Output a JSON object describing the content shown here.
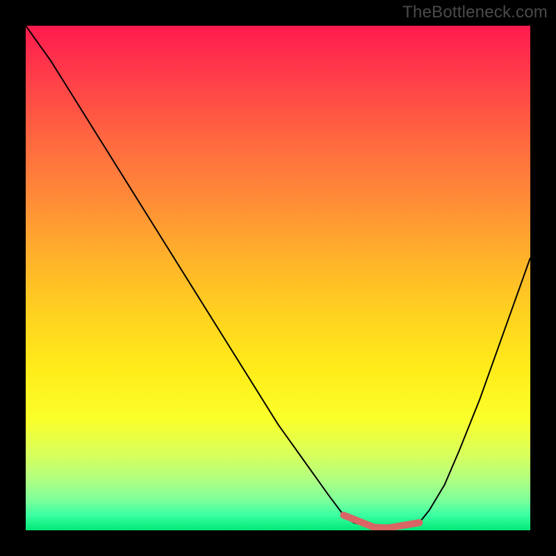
{
  "attribution": "TheBottleneck.com",
  "chart_data": {
    "type": "line",
    "title": "",
    "xlabel": "",
    "ylabel": "",
    "xlim": [
      0,
      100
    ],
    "ylim": [
      0,
      100
    ],
    "x": [
      0,
      5,
      10,
      15,
      20,
      25,
      30,
      35,
      40,
      45,
      50,
      55,
      60,
      63,
      65,
      68,
      70,
      72,
      75,
      78,
      80,
      83,
      86,
      90,
      95,
      100
    ],
    "values": [
      100,
      93,
      85,
      77,
      69,
      61,
      53,
      45,
      37,
      29,
      21,
      14,
      7,
      3,
      1.5,
      0.7,
      0.5,
      0.5,
      0.7,
      1.5,
      4,
      9,
      16,
      26,
      40,
      54
    ],
    "flat_region_x": [
      63,
      78
    ],
    "annotations": "A V-shaped curve descending linearly from upper-left, flattening near the bottom between ~63% and ~78% x (highlighted in red), then rising toward the right edge with increasing slope."
  },
  "colors": {
    "curve": "#000000",
    "highlight": "#d96565",
    "frame": "#000000"
  }
}
